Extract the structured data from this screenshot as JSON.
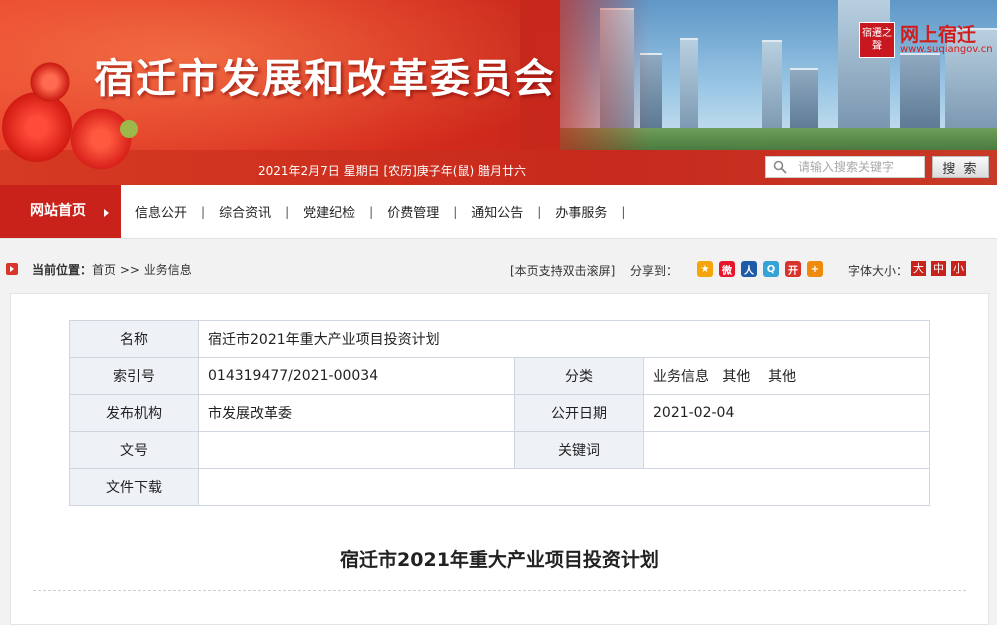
{
  "header": {
    "site_title": "宿迁市发展和改革委员会",
    "date_line": "2021年2月7日  星期日  [农历]庚子年(鼠) 腊月廿六",
    "logo_badge": "宿遷之聲",
    "logo_text": "网上宿迁",
    "logo_url": "www.suqiangov.cn",
    "search_placeholder": "请输入搜索关键字",
    "search_button": "搜 索",
    "search_icon": "search-icon"
  },
  "nav": {
    "home": "网站首页",
    "items": [
      {
        "label": "信息公开"
      },
      {
        "label": "综合资讯"
      },
      {
        "label": "党建纪检"
      },
      {
        "label": "价费管理"
      },
      {
        "label": "通知公告"
      },
      {
        "label": "办事服务"
      }
    ],
    "separator": "|"
  },
  "location": {
    "label": "当前位置：",
    "crumb": "首页 >> 业务信息",
    "double_click_tip": "[本页支持双击滚屏]",
    "share_label": "分享到：",
    "share_icons": [
      {
        "name": "qzone-icon",
        "glyph": "★",
        "color": "#f5a50a"
      },
      {
        "name": "weibo-icon",
        "glyph": "微",
        "color": "#e6162d"
      },
      {
        "name": "renren-icon",
        "glyph": "人",
        "color": "#1f5ca8"
      },
      {
        "name": "qq-weibo-icon",
        "glyph": "Q",
        "color": "#35a2d8"
      },
      {
        "name": "kaixin-icon",
        "glyph": "开",
        "color": "#d7342c"
      },
      {
        "name": "more-share-icon",
        "glyph": "+",
        "color": "#f08a0c"
      }
    ],
    "font_size_label": "字体大小：",
    "font_sizes": [
      "大",
      "中",
      "小"
    ]
  },
  "meta": {
    "name_label": "名称",
    "name_value": "宿迁市2021年重大产业项目投资计划",
    "index_label": "索引号",
    "index_value": "014319477/2021-00034",
    "category_label": "分类",
    "category_value": "业务信息   其他    其他",
    "publisher_label": "发布机构",
    "publisher_value": "市发展改革委",
    "date_label": "公开日期",
    "date_value": "2021-02-04",
    "docno_label": "文号",
    "docno_value": "",
    "keywords_label": "关键词",
    "keywords_value": "",
    "download_label": "文件下载",
    "download_value": ""
  },
  "document": {
    "title": "宿迁市2021年重大产业项目投资计划"
  },
  "colors": {
    "brand_red": "#c8221a",
    "table_header_bg": "#eef2f7"
  }
}
